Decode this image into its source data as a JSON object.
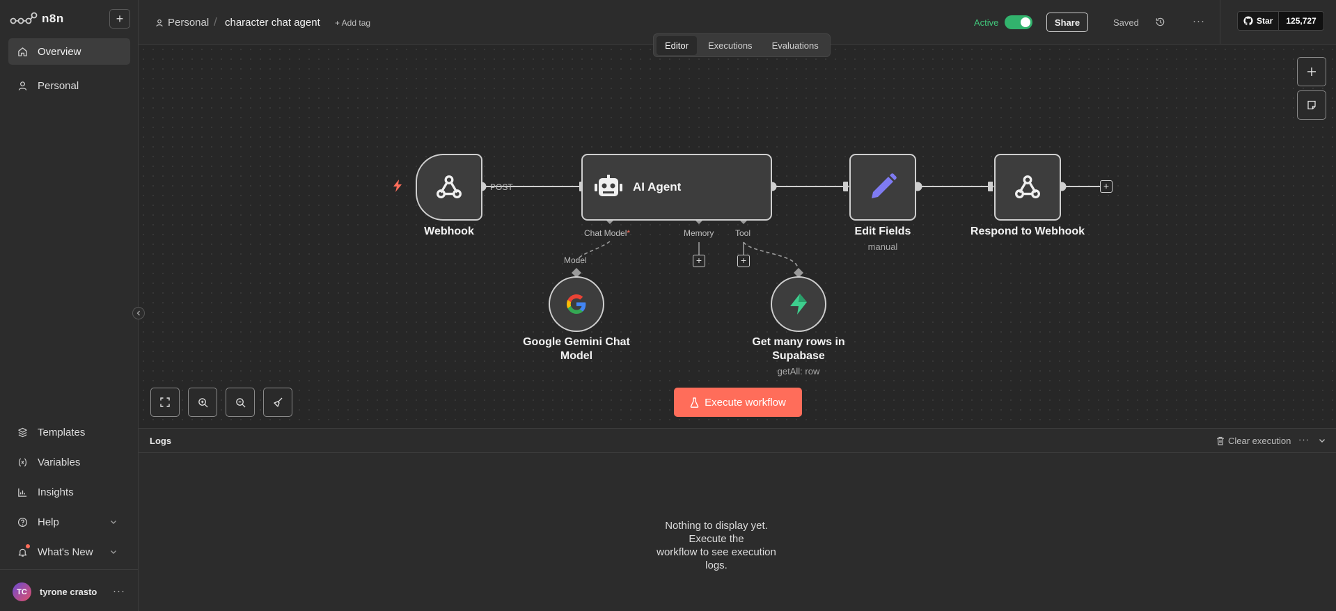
{
  "app": {
    "brand": "n8n"
  },
  "sidebar": {
    "new_label": "+",
    "items": [
      {
        "label": "Overview",
        "icon": "home-icon",
        "active": true
      },
      {
        "label": "Personal",
        "icon": "user-icon",
        "active": false
      }
    ],
    "bottom_items": [
      {
        "label": "Templates",
        "icon": "templates-icon"
      },
      {
        "label": "Variables",
        "icon": "variables-icon"
      },
      {
        "label": "Insights",
        "icon": "insights-icon"
      },
      {
        "label": "Help",
        "icon": "help-icon"
      },
      {
        "label": "What's New",
        "icon": "bell-icon"
      }
    ],
    "user": {
      "initials": "TC",
      "name": "tyrone crasto",
      "more": "···"
    }
  },
  "header": {
    "breadcrumb_project": "Personal",
    "breadcrumb_sep": "/",
    "workflow_name": "character chat agent",
    "add_tag": "+ Add tag",
    "active_label": "Active",
    "active": true,
    "share_label": "Share",
    "saved_label": "Saved",
    "more": "···",
    "github": {
      "star_label": "Star",
      "count": "125,727"
    }
  },
  "tabs": [
    {
      "label": "Editor",
      "active": true
    },
    {
      "label": "Executions",
      "active": false
    },
    {
      "label": "Evaluations",
      "active": false
    }
  ],
  "workflow": {
    "nodes": {
      "webhook": {
        "title": "Webhook",
        "icon": "webhook-icon"
      },
      "agent": {
        "title": "AI Agent",
        "icon": "robot-icon"
      },
      "edit": {
        "title": "Edit Fields",
        "subtitle": "manual",
        "icon": "pencil-icon"
      },
      "respond": {
        "title": "Respond to Webhook",
        "icon": "webhook-icon"
      },
      "gemini": {
        "title": "Google Gemini Chat Model",
        "icon": "google-icon"
      },
      "supabase": {
        "title": "Get many rows in Supabase",
        "subtitle": "getAll: row",
        "icon": "supabase-icon"
      }
    },
    "labels": {
      "post": "POST",
      "chat_model": "Chat Model",
      "chat_model_required": "*",
      "memory": "Memory",
      "tool": "Tool",
      "model": "Model"
    },
    "execute_label": "Execute workflow"
  },
  "logs": {
    "title": "Logs",
    "clear_label": "Clear execution",
    "more": "···",
    "empty_line1": "Nothing to display yet. Execute the",
    "empty_line2": "workflow to see execution logs."
  },
  "colors": {
    "accent": "#ff6d5a",
    "active_green": "#32b36d",
    "pencil": "#7f7bf2",
    "supabase": "#3ecf8e"
  }
}
